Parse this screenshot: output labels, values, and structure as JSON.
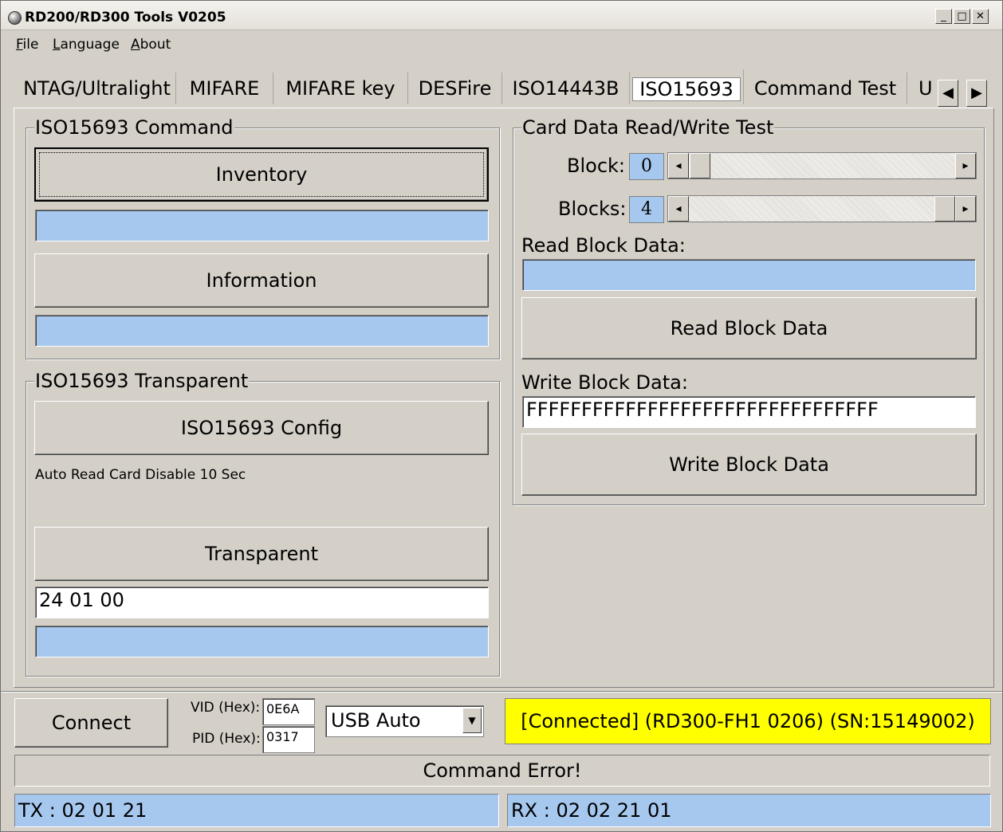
{
  "window": {
    "title": "RD200/RD300 Tools V0205",
    "minimize": "_",
    "maximize": "□",
    "close": "✕"
  },
  "menu": {
    "file": "File",
    "language": "Language",
    "about": "About"
  },
  "tabs": [
    {
      "label": "NTAG/Ultralight"
    },
    {
      "label": "MIFARE"
    },
    {
      "label": "MIFARE key"
    },
    {
      "label": "DESFire"
    },
    {
      "label": "ISO14443B"
    },
    {
      "label": "ISO15693",
      "active": true
    },
    {
      "label": "Command Test"
    },
    {
      "label": "U"
    }
  ],
  "tab_scroll": {
    "left": "◀",
    "right": "▶"
  },
  "iso_command": {
    "title": "ISO15693 Command",
    "inventory": "Inventory",
    "information": "Information"
  },
  "iso_transparent": {
    "title": "ISO15693 Transparent",
    "config": "ISO15693 Config",
    "auto_read": "Auto Read Card Disable 10 Sec",
    "transparent": "Transparent",
    "command_value": "24 01 00"
  },
  "card_test": {
    "title": "Card Data Read/Write Test",
    "block_label": "Block:",
    "block_value": "0",
    "blocks_label": "Blocks:",
    "blocks_value": "4",
    "read_label": "Read Block Data:",
    "read_button": "Read Block Data",
    "write_label": "Write Block Data:",
    "write_value": "FFFFFFFFFFFFFFFFFFFFFFFFFFFFFFFF",
    "write_button": "Write Block Data"
  },
  "bottom": {
    "connect": "Connect",
    "vid_label": "VID (Hex):",
    "vid_value": "0E6A",
    "pid_label": "PID (Hex):",
    "pid_value": "0317",
    "mode": "USB Auto",
    "connection_status": "[Connected] (RD300-FH1    0206) (SN:15149002)",
    "connection_status_color": "#ffff00",
    "message": "Command Error!",
    "tx": "TX : 02 01 21",
    "rx": "RX : 02 02 21 01"
  },
  "colors": {
    "field_blue": "#a6c8ef",
    "face": "#d4d0c8"
  }
}
